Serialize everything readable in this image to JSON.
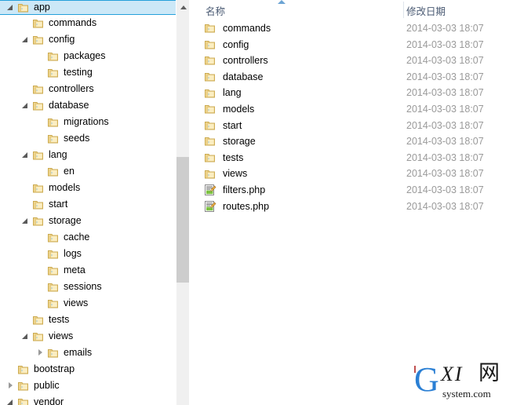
{
  "tree": {
    "scrollbar": {
      "up_arrow": "scroll-up-arrow"
    },
    "items": [
      {
        "label": "app",
        "level": 0,
        "twisty": "expanded",
        "selected": true
      },
      {
        "label": "commands",
        "level": 1,
        "twisty": "none",
        "selected": false
      },
      {
        "label": "config",
        "level": 1,
        "twisty": "expanded",
        "selected": false
      },
      {
        "label": "packages",
        "level": 2,
        "twisty": "none",
        "selected": false
      },
      {
        "label": "testing",
        "level": 2,
        "twisty": "none",
        "selected": false
      },
      {
        "label": "controllers",
        "level": 1,
        "twisty": "none",
        "selected": false
      },
      {
        "label": "database",
        "level": 1,
        "twisty": "expanded",
        "selected": false
      },
      {
        "label": "migrations",
        "level": 2,
        "twisty": "none",
        "selected": false
      },
      {
        "label": "seeds",
        "level": 2,
        "twisty": "none",
        "selected": false
      },
      {
        "label": "lang",
        "level": 1,
        "twisty": "expanded",
        "selected": false
      },
      {
        "label": "en",
        "level": 2,
        "twisty": "none",
        "selected": false
      },
      {
        "label": "models",
        "level": 1,
        "twisty": "none",
        "selected": false
      },
      {
        "label": "start",
        "level": 1,
        "twisty": "none",
        "selected": false
      },
      {
        "label": "storage",
        "level": 1,
        "twisty": "expanded",
        "selected": false
      },
      {
        "label": "cache",
        "level": 2,
        "twisty": "none",
        "selected": false
      },
      {
        "label": "logs",
        "level": 2,
        "twisty": "none",
        "selected": false
      },
      {
        "label": "meta",
        "level": 2,
        "twisty": "none",
        "selected": false
      },
      {
        "label": "sessions",
        "level": 2,
        "twisty": "none",
        "selected": false
      },
      {
        "label": "views",
        "level": 2,
        "twisty": "none",
        "selected": false
      },
      {
        "label": "tests",
        "level": 1,
        "twisty": "none",
        "selected": false
      },
      {
        "label": "views",
        "level": 1,
        "twisty": "expanded",
        "selected": false
      },
      {
        "label": "emails",
        "level": 2,
        "twisty": "collapsed",
        "selected": false
      },
      {
        "label": "bootstrap",
        "level": 0,
        "twisty": "none",
        "selected": false
      },
      {
        "label": "public",
        "level": 0,
        "twisty": "collapsed",
        "selected": false
      },
      {
        "label": "vendor",
        "level": 0,
        "twisty": "expanded",
        "selected": false
      }
    ]
  },
  "list": {
    "columns": {
      "name": "名称",
      "date_modified": "修改日期"
    },
    "sort_indicator": "sort-ascending-icon",
    "rows": [
      {
        "name": "commands",
        "icon": "folder-icon",
        "date": "2014-03-03 18:07"
      },
      {
        "name": "config",
        "icon": "folder-icon",
        "date": "2014-03-03 18:07"
      },
      {
        "name": "controllers",
        "icon": "folder-icon",
        "date": "2014-03-03 18:07"
      },
      {
        "name": "database",
        "icon": "folder-icon",
        "date": "2014-03-03 18:07"
      },
      {
        "name": "lang",
        "icon": "folder-icon",
        "date": "2014-03-03 18:07"
      },
      {
        "name": "models",
        "icon": "folder-icon",
        "date": "2014-03-03 18:07"
      },
      {
        "name": "start",
        "icon": "folder-icon",
        "date": "2014-03-03 18:07"
      },
      {
        "name": "storage",
        "icon": "folder-icon",
        "date": "2014-03-03 18:07"
      },
      {
        "name": "tests",
        "icon": "folder-icon",
        "date": "2014-03-03 18:07"
      },
      {
        "name": "views",
        "icon": "folder-icon",
        "date": "2014-03-03 18:07"
      },
      {
        "name": "filters.php",
        "icon": "php-file-icon",
        "date": "2014-03-03 18:07"
      },
      {
        "name": "routes.php",
        "icon": "php-file-icon",
        "date": "2014-03-03 18:07"
      }
    ]
  },
  "watermark": {
    "letter": "G",
    "middle": "XI",
    "cjk": "网",
    "subtitle": "system.com"
  },
  "colors": {
    "selection_fill": "#cce8f7",
    "selection_border": "#26a0da",
    "header_text": "#4a5a73",
    "date_text": "#9a9a9a",
    "scrollbar_track": "#f0f0f0",
    "scrollbar_thumb": "#cdcdcd",
    "watermark_blue": "#2a7fd4"
  }
}
